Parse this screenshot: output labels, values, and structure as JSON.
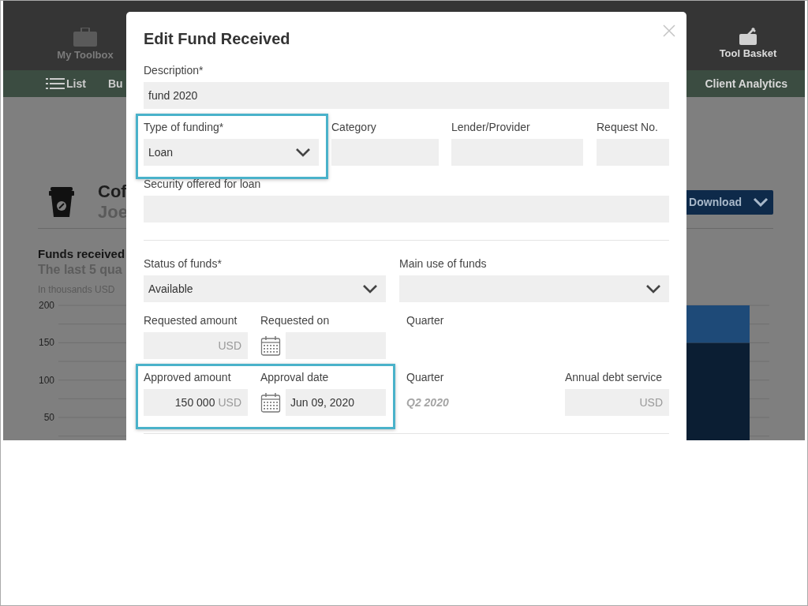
{
  "header": {
    "items": [
      {
        "label": "My Toolbox",
        "selected": false
      },
      {
        "label": "Tool Basket",
        "selected": false
      }
    ]
  },
  "nav_bar": {
    "items": [
      {
        "label": "List"
      },
      {
        "label": "Bu"
      },
      {
        "label": "Client Analytics"
      }
    ]
  },
  "company": {
    "name": "Cof",
    "owner": "Joe"
  },
  "download_button": {
    "label": "Download"
  },
  "funds_chart": {
    "title": "Funds received",
    "subtitle": "The last 5 qua",
    "chart_data": {
      "type": "bar",
      "stacked": true,
      "grid": true,
      "ylabel": "In thousands USD",
      "yticks": [
        50,
        100,
        150,
        200
      ],
      "ylim": [
        0,
        200
      ],
      "series": [
        {
          "color": "#0b1e33",
          "values": [
            150
          ]
        },
        {
          "color": "#1e4a78",
          "values": [
            50
          ]
        }
      ]
    }
  },
  "dialog": {
    "title": "Edit Fund Received",
    "sections": [
      {
        "rows": [
          {
            "fields": [
              {
                "kind": "text",
                "label": "Description*",
                "value": "fund 2020",
                "highlighted": false
              }
            ]
          },
          {
            "fields": [
              {
                "kind": "select",
                "label": "Type of funding*",
                "value": "Loan",
                "highlighted": true
              },
              {
                "kind": "text",
                "label": "Category",
                "highlighted": false
              },
              {
                "kind": "text",
                "label": "Lender/Provider",
                "highlighted": false
              },
              {
                "kind": "text",
                "label": "Request No.",
                "highlighted": false
              }
            ]
          },
          {
            "fields": [
              {
                "kind": "text",
                "label": "Security offered for loan",
                "highlighted": false
              }
            ]
          }
        ]
      },
      {
        "rows": [
          {
            "fields": [
              {
                "kind": "select",
                "label": "Status of funds*",
                "value": "Available",
                "highlighted": false
              },
              {
                "kind": "select",
                "label": "Main use of funds",
                "highlighted": false
              }
            ]
          },
          {
            "fields": [
              {
                "kind": "money",
                "label": "Requested amount",
                "unit": "USD",
                "highlighted": false
              },
              {
                "kind": "date",
                "label": "Requested on",
                "highlighted": false
              },
              {
                "kind": "readonly",
                "label": "Quarter",
                "highlighted": false
              }
            ]
          },
          {
            "fields": [
              {
                "kind": "money",
                "label": "Approved amount",
                "value": "150 000",
                "unit": "USD",
                "highlighted": true
              },
              {
                "kind": "date",
                "label": "Approval date",
                "value": "Jun 09, 2020",
                "highlighted": true
              },
              {
                "kind": "readonly",
                "label": "Quarter",
                "value": "Q2 2020",
                "highlighted": false
              },
              {
                "kind": "money",
                "label": "Annual debt service",
                "unit": "USD",
                "highlighted": false
              }
            ]
          }
        ]
      }
    ]
  }
}
